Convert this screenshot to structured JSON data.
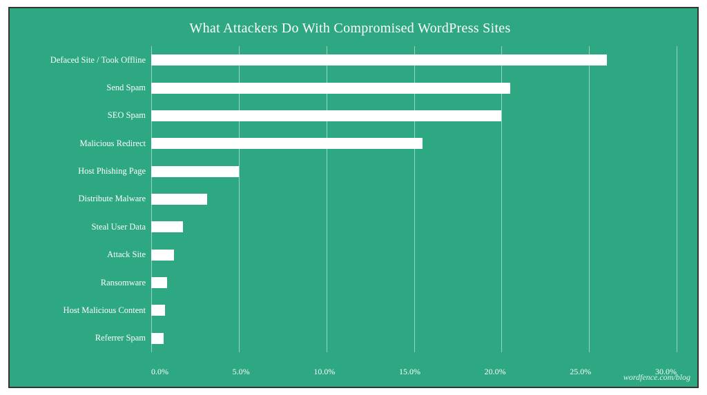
{
  "chart": {
    "title": "What Attackers Do With Compromised WordPress Sites",
    "watermark": "wordfence.com/blog",
    "background_color": "#2da882",
    "bars": [
      {
        "label": "Defaced Site / Took Offline",
        "value": 26.0,
        "pct": 86.67
      },
      {
        "label": "Send Spam",
        "value": 20.5,
        "pct": 68.33
      },
      {
        "label": "SEO Spam",
        "value": 20.0,
        "pct": 66.67
      },
      {
        "label": "Malicious Redirect",
        "value": 15.5,
        "pct": 51.67
      },
      {
        "label": "Host Phishing Page",
        "value": 5.0,
        "pct": 16.67
      },
      {
        "label": "Distribute Malware",
        "value": 3.2,
        "pct": 10.67
      },
      {
        "label": "Steal User Data",
        "value": 1.8,
        "pct": 6.0
      },
      {
        "label": "Attack Site",
        "value": 1.3,
        "pct": 4.33
      },
      {
        "label": "Ransomware",
        "value": 0.9,
        "pct": 3.0
      },
      {
        "label": "Host Malicious Content",
        "value": 0.8,
        "pct": 2.67
      },
      {
        "label": "Referrer Spam",
        "value": 0.7,
        "pct": 2.33
      }
    ],
    "x_axis": {
      "labels": [
        "0.0%",
        "5.0%",
        "10.0%",
        "15.0%",
        "20.0%",
        "25.0%",
        "30.0%"
      ],
      "max_value": 30.0
    }
  }
}
